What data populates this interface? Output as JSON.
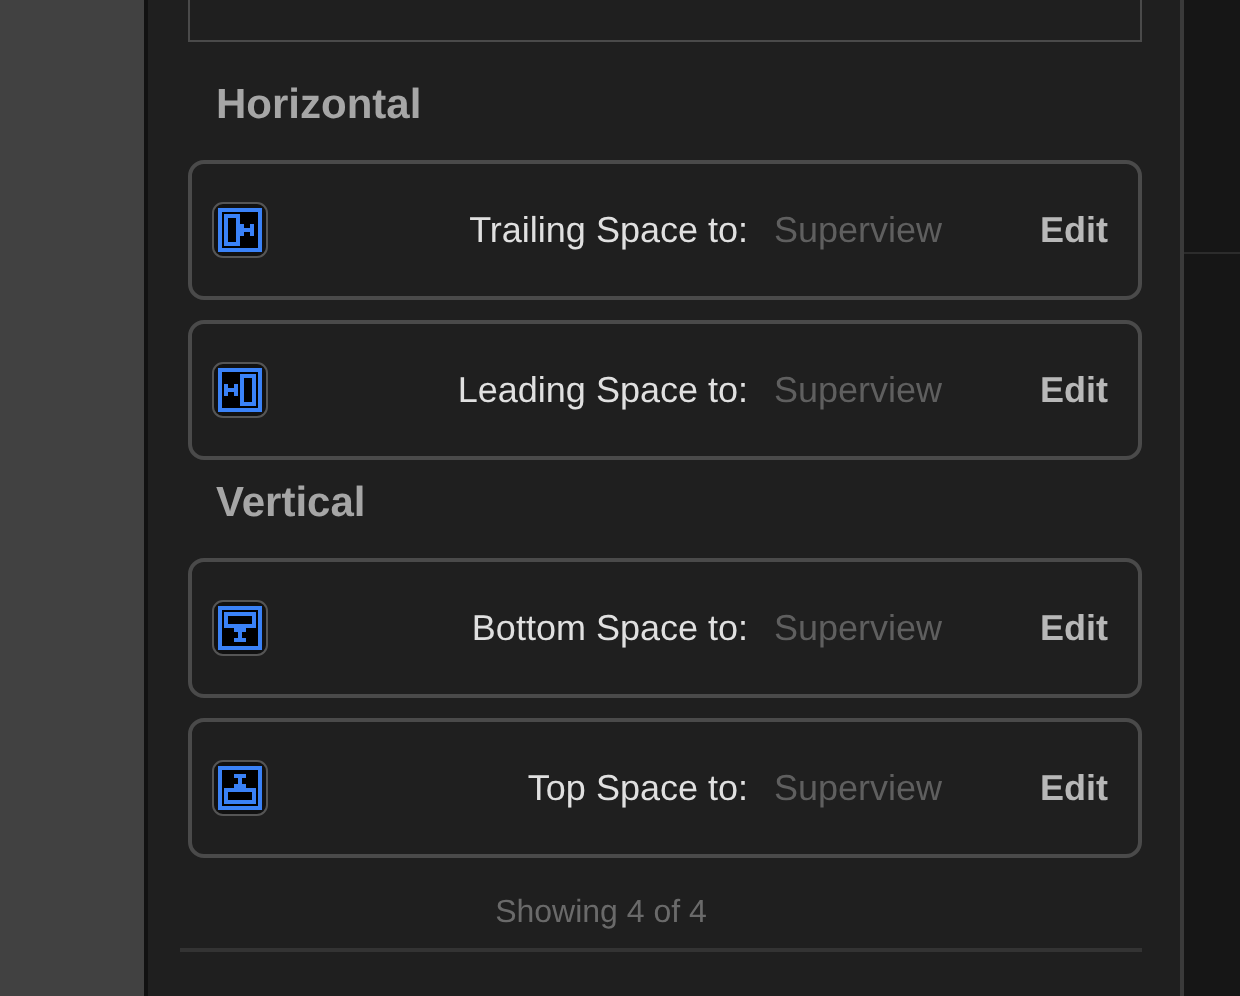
{
  "sections": [
    {
      "title": "Horizontal",
      "constraints": [
        {
          "kind": "trailing",
          "label": "Trailing Space to:",
          "target": "Superview",
          "action": "Edit"
        },
        {
          "kind": "leading",
          "label": "Leading Space to:",
          "target": "Superview",
          "action": "Edit"
        }
      ]
    },
    {
      "title": "Vertical",
      "constraints": [
        {
          "kind": "bottom",
          "label": "Bottom Space to:",
          "target": "Superview",
          "action": "Edit"
        },
        {
          "kind": "top",
          "label": "Top Space to:",
          "target": "Superview",
          "action": "Edit"
        }
      ]
    }
  ],
  "footer": "Showing 4 of 4"
}
